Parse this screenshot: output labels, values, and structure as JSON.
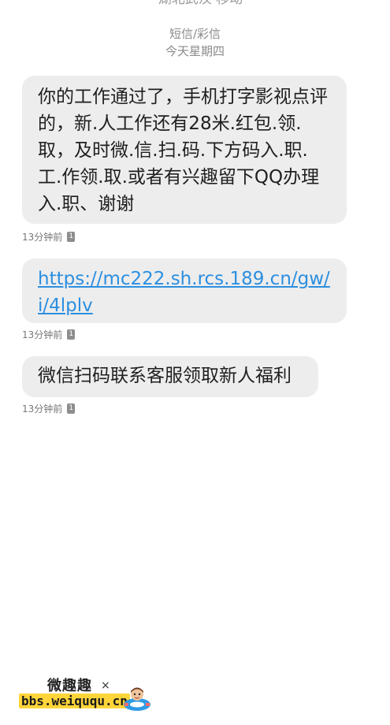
{
  "header": {
    "sender": "湖北武汉 移动",
    "message_type": "短信/彩信",
    "date": "今天星期四"
  },
  "messages": [
    {
      "text": "你的工作通过了，手机打字影视点评的，新.人工作还有28米.红包.领.取，及时微.信.扫.码.下方码入.职.工.作领.取.或者有兴趣留下QQ办理入.职、谢谢",
      "time": "13分钟前",
      "sim": "1"
    },
    {
      "text": "https://mc222.sh.rcs.189.cn/gw/i/4lplv",
      "time": "13分钟前",
      "sim": "1"
    },
    {
      "text": "微信扫码联系客服领取新人福利",
      "time": "13分钟前",
      "sim": "1"
    }
  ],
  "watermark": {
    "name": "微趣趣",
    "url": "bbs.weiququ.cn",
    "mark": "×",
    "logo_icon": "swim-ring-mascot-icon"
  },
  "colors": {
    "bubble": "#ededed",
    "link": "#2c8fe0",
    "meta": "#8a8a8a",
    "watermark_bg": "#ffd53a"
  }
}
